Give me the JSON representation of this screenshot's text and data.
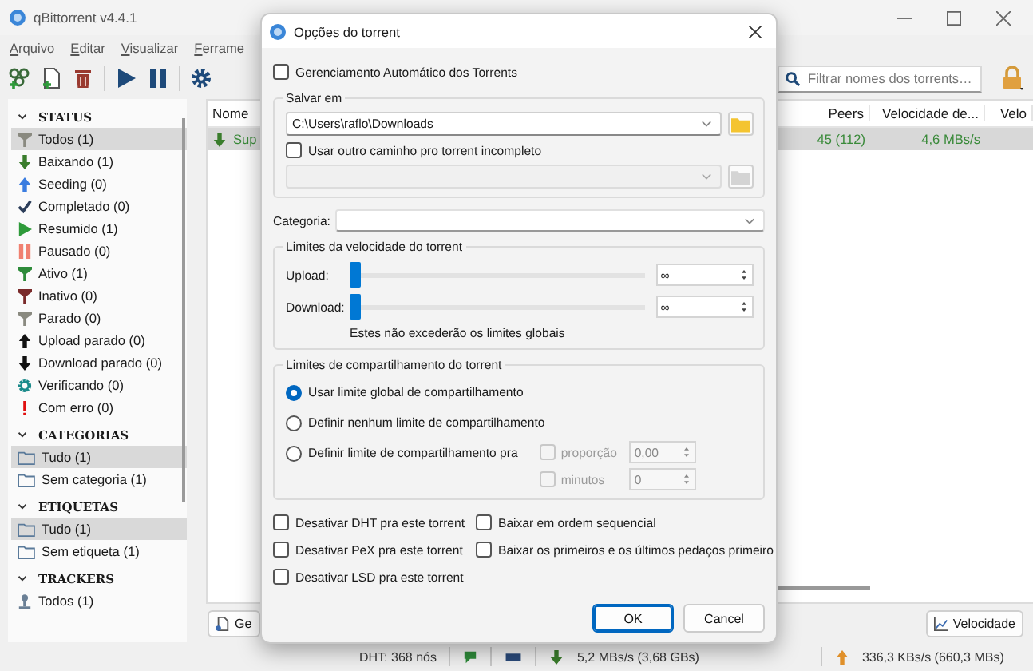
{
  "app": {
    "title": "qBittorrent v4.4.1"
  },
  "menu": [
    {
      "label": "Arquivo"
    },
    {
      "label": "Editar"
    },
    {
      "label": "Visualizar"
    },
    {
      "label": "Ferrame"
    }
  ],
  "search": {
    "placeholder": "Filtrar nomes dos torrents…"
  },
  "sidebar": [
    {
      "title": "STATUS",
      "expanded": true,
      "items": [
        {
          "label": "Todos (1)",
          "selected": true
        },
        {
          "label": "Baixando (1)",
          "selected": false
        },
        {
          "label": "Seeding (0)",
          "selected": false
        },
        {
          "label": "Completado (0)",
          "selected": false
        },
        {
          "label": "Resumido (1)",
          "selected": false
        },
        {
          "label": "Pausado (0)",
          "selected": false
        },
        {
          "label": "Ativo (1)",
          "selected": false
        },
        {
          "label": "Inativo (0)",
          "selected": false
        },
        {
          "label": "Parado (0)",
          "selected": false
        },
        {
          "label": "Upload parado (0)",
          "selected": false
        },
        {
          "label": "Download parado (0)",
          "selected": false
        },
        {
          "label": "Verificando (0)",
          "selected": false
        },
        {
          "label": "Com erro (0)",
          "selected": false
        }
      ]
    },
    {
      "title": "CATEGORIAS",
      "expanded": true,
      "items": [
        {
          "label": "Tudo (1)",
          "selected": true
        },
        {
          "label": "Sem categoria (1)",
          "selected": false
        }
      ]
    },
    {
      "title": "ETIQUETAS",
      "expanded": true,
      "items": [
        {
          "label": "Tudo (1)",
          "selected": true
        },
        {
          "label": "Sem etiqueta (1)",
          "selected": false
        }
      ]
    },
    {
      "title": "TRACKERS",
      "expanded": true,
      "items": [
        {
          "label": "Todos (1)",
          "selected": false
        }
      ]
    }
  ],
  "table": {
    "columns": [
      "Nome",
      "Peers",
      "Velocidade de...",
      "Velo"
    ],
    "rows": [
      {
        "name": "Sup",
        "peers": "45 (112)",
        "speed": "4,6 MBs/s",
        "selected": true
      }
    ]
  },
  "bottom_buttons": [
    {
      "label": "Ge"
    },
    {
      "label": "Velocidade"
    }
  ],
  "status_bar": {
    "dht": "DHT: 368 nós",
    "download": "5,2 MBs/s (3,68 GBs)",
    "upload": "336,3 KBs/s (660,3 MBs)"
  },
  "dialog": {
    "title": "Opções do torrent",
    "auto_management": {
      "label": "Gerenciamento Automático dos Torrents",
      "checked": false
    },
    "save_group": {
      "title": "Salvar em",
      "path": "C:\\Users\\raflo\\Downloads",
      "use_other": {
        "label": "Usar outro caminho pro torrent incompleto",
        "checked": false
      },
      "other_path_disabled": true
    },
    "category": {
      "label": "Categoria:"
    },
    "speed_group": {
      "title": "Limites da velocidade do torrent",
      "limits": [
        {
          "label": "Upload:",
          "level": 0,
          "value": "∞"
        },
        {
          "label": "Download:",
          "level": 0,
          "value": "∞"
        }
      ],
      "note": "Estes não excederão os limites globais"
    },
    "share_group": {
      "title": "Limites de compartilhamento do torrent",
      "options": [
        {
          "label": "Usar limite global de compartilhamento",
          "selected": true
        },
        {
          "label": "Definir nenhum limite de compartilhamento",
          "selected": false
        },
        {
          "label": "Definir limite de compartilhamento pra",
          "selected": false
        }
      ],
      "limits": [
        {
          "label": "proporção",
          "checked": false,
          "disabled": true,
          "value": "0,00"
        },
        {
          "label": "minutos",
          "checked": false,
          "disabled": true,
          "value": "0"
        }
      ]
    },
    "toggles": [
      {
        "label": "Desativar DHT pra este torrent",
        "checked": false
      },
      {
        "label": "Baixar em ordem sequencial",
        "checked": false
      },
      {
        "label": "Desativar PeX pra este torrent",
        "checked": false
      },
      {
        "label": "Baixar os primeiros e os últimos pedaços primeiro",
        "checked": false
      },
      {
        "label": "Desativar LSD pra este torrent",
        "checked": false
      }
    ],
    "buttons": [
      {
        "label": "OK",
        "default": true
      },
      {
        "label": "Cancel",
        "default": false
      }
    ]
  }
}
